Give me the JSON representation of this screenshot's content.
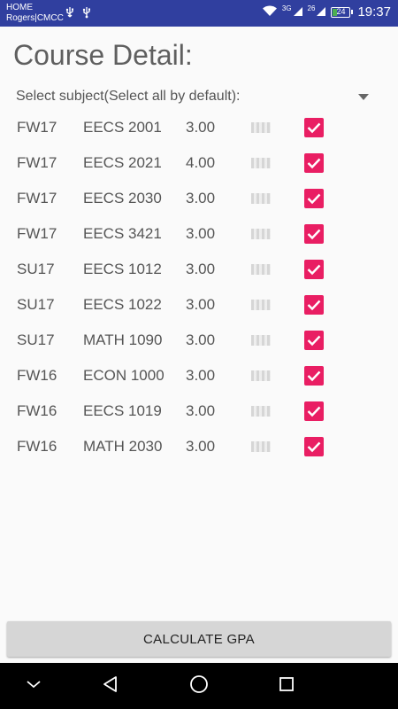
{
  "status_bar": {
    "carrier_line1": "HOME",
    "carrier_line2": "Rogers|CMCC",
    "network_3g": "3G",
    "network_26": "26",
    "battery_level": "24",
    "time": "19:37",
    "bar_color": "#303f9f"
  },
  "page_title": "Course Detail:",
  "subject_filter": {
    "label": "Select subject(Select all by default):"
  },
  "courses": [
    {
      "term": "FW17",
      "code": "EECS 2001",
      "credits": "3.00",
      "checked": true
    },
    {
      "term": "FW17",
      "code": "EECS 2021",
      "credits": "4.00",
      "checked": true
    },
    {
      "term": "FW17",
      "code": "EECS 2030",
      "credits": "3.00",
      "checked": true
    },
    {
      "term": "FW17",
      "code": "EECS 3421",
      "credits": "3.00",
      "checked": true
    },
    {
      "term": "SU17",
      "code": "EECS 1012",
      "credits": "3.00",
      "checked": true
    },
    {
      "term": "SU17",
      "code": "EECS 1022",
      "credits": "3.00",
      "checked": true
    },
    {
      "term": "SU17",
      "code": "MATH 1090",
      "credits": "3.00",
      "checked": true
    },
    {
      "term": "FW16",
      "code": "ECON 1000",
      "credits": "3.00",
      "checked": true
    },
    {
      "term": "FW16",
      "code": "EECS 1019",
      "credits": "3.00",
      "checked": true
    },
    {
      "term": "FW16",
      "code": "MATH 2030",
      "credits": "3.00",
      "checked": true
    }
  ],
  "calculate_button": "CALCULATE GPA",
  "colors": {
    "checkbox_accent": "#e91e63",
    "button_bg": "#d6d6d6",
    "nav_bar": "#000000"
  },
  "icons": {
    "usb": "usb-icon",
    "wifi": "wifi-icon",
    "signal": "signal-icon",
    "battery": "battery-icon",
    "dropdown": "dropdown-arrow-icon",
    "checkbox": "check-icon",
    "nav_down": "chevron-down-icon",
    "nav_back": "back-icon",
    "nav_home": "home-icon",
    "nav_recent": "recents-icon"
  }
}
